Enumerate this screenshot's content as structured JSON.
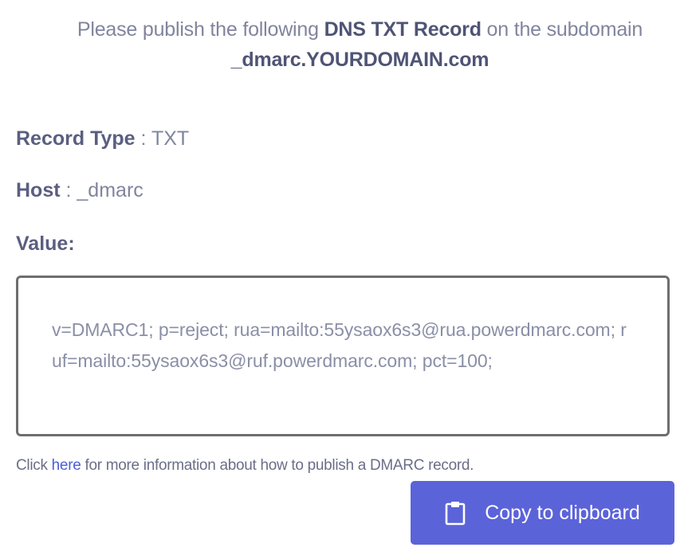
{
  "intro": {
    "prefix": "Please publish the following ",
    "record_name": "DNS TXT Record",
    "middle": " on the subdomain",
    "subdomain": "_dmarc.YOURDOMAIN.com"
  },
  "fields": {
    "record_type_label": "Record Type",
    "record_type_sep": " : ",
    "record_type_value": "TXT",
    "host_label": "Host",
    "host_sep": " : ",
    "host_value": "_dmarc",
    "value_label": "Value:"
  },
  "value_box": {
    "text": "v=DMARC1; p=reject; rua=mailto:55ysaox6s3@rua.powerdmarc.com; ruf=mailto:55ysaox6s3@ruf.powerdmarc.com; pct=100;"
  },
  "help": {
    "prefix": "Click ",
    "link": "here",
    "suffix": " for more information about how to publish a DMARC record."
  },
  "copy_button": {
    "label": "Copy to clipboard",
    "icon": "clipboard-icon",
    "color": "#5b63d9"
  }
}
